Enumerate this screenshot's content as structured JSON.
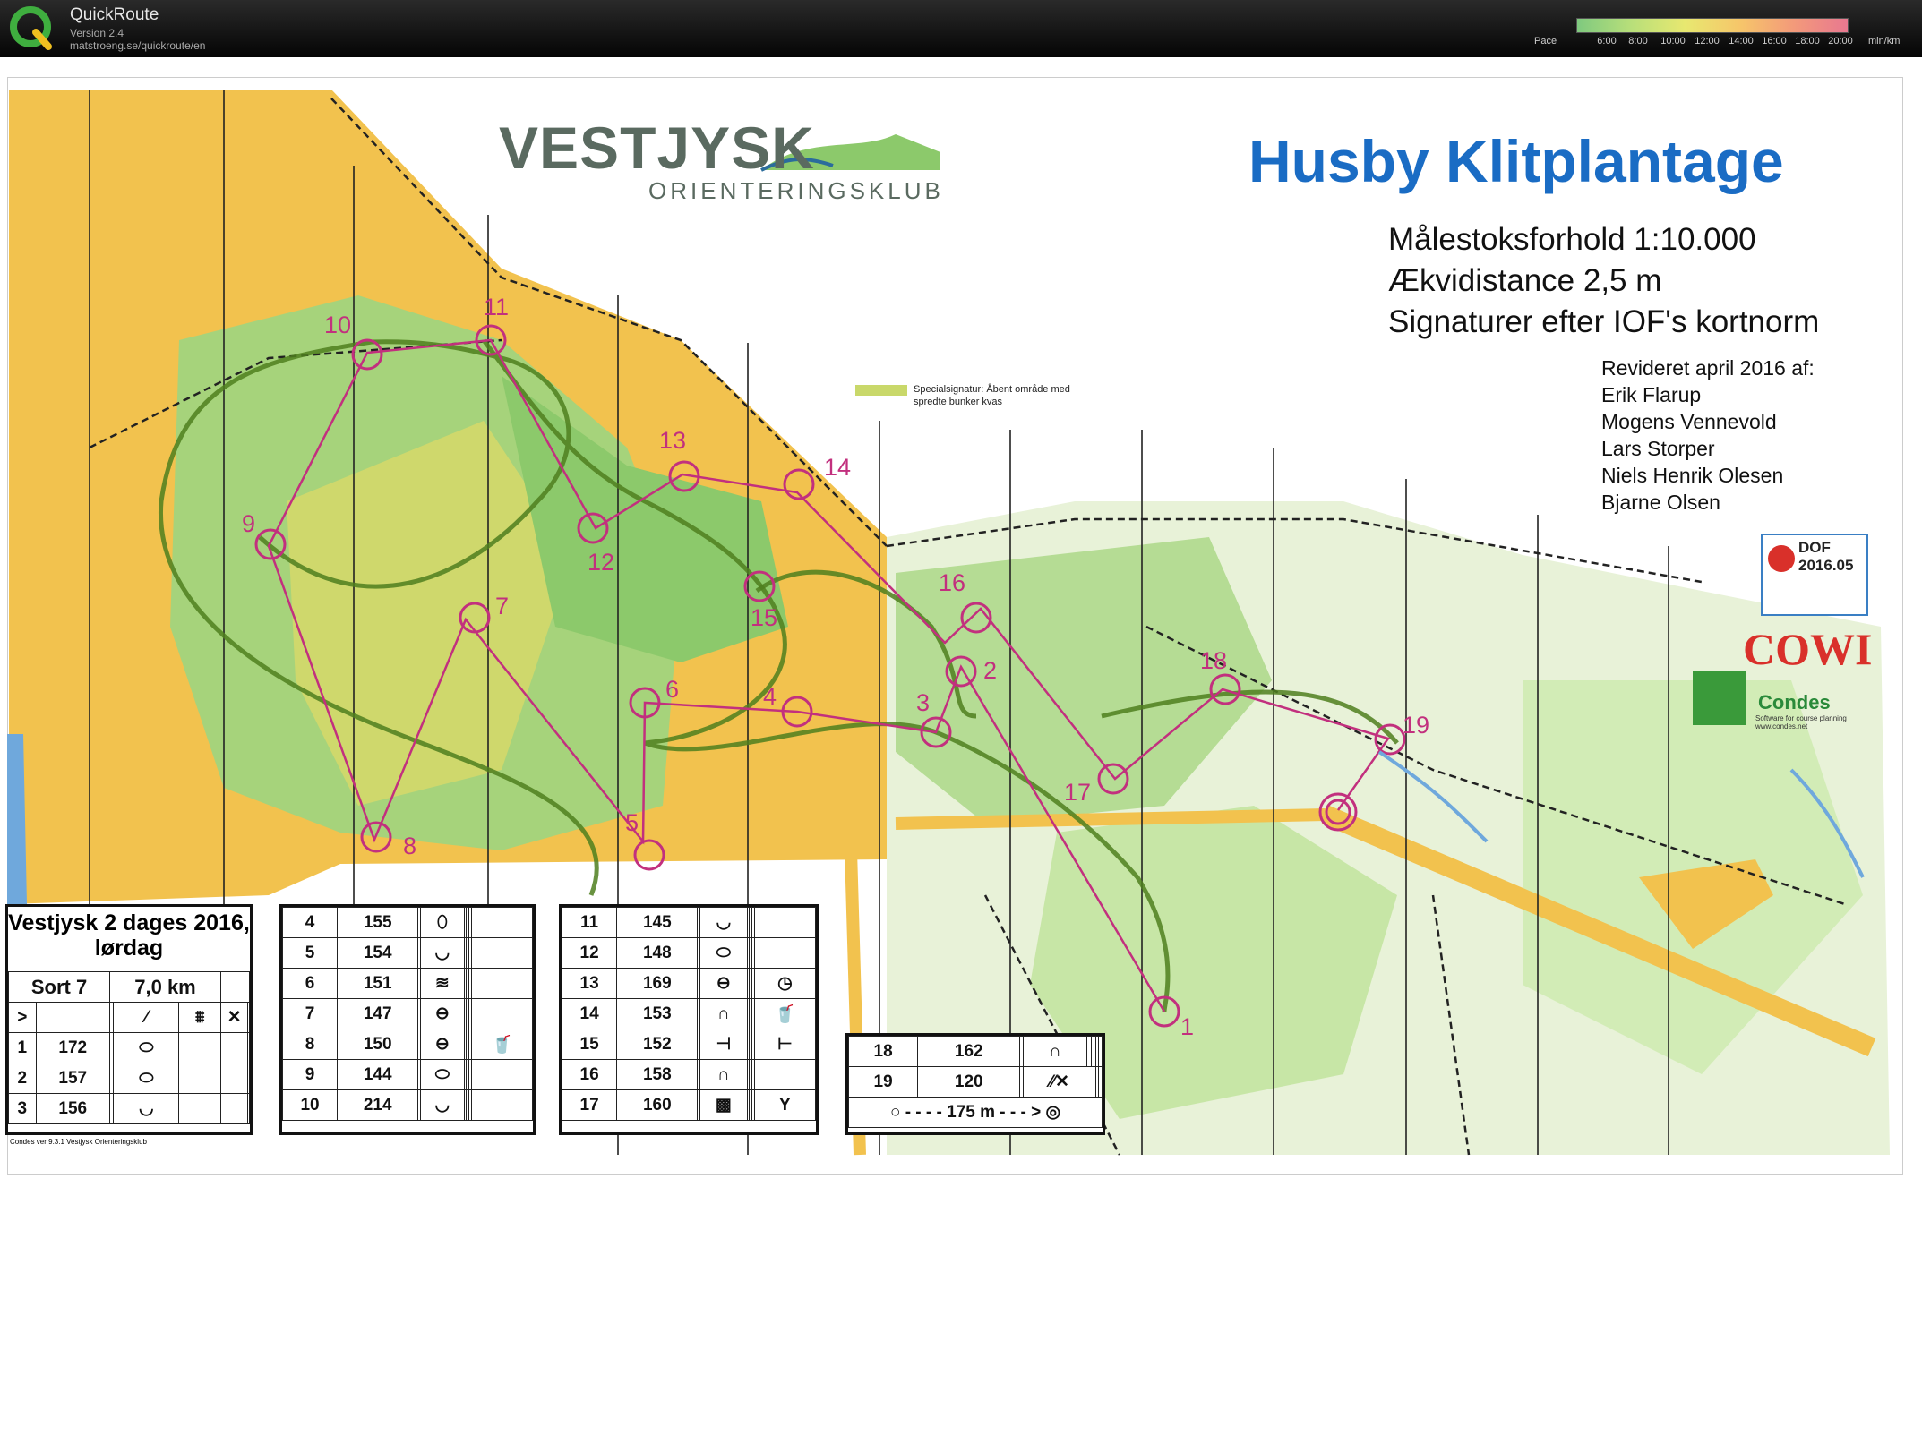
{
  "app": {
    "title": "QuickRoute",
    "version": "Version 2.4",
    "url": "matstroeng.se/quickroute/en"
  },
  "pace": {
    "label": "Pace",
    "ticks": [
      "6:00",
      "8:00",
      "10:00",
      "12:00",
      "14:00",
      "16:00",
      "18:00",
      "20:00"
    ],
    "unit": "min/km",
    "gradient": [
      "#7fc97f",
      "#b8df7a",
      "#e8e870",
      "#f6c66a",
      "#f39a7a",
      "#e87890"
    ]
  },
  "map": {
    "club_name": "VESTJYSK",
    "club_sub": "ORIENTERINGSKLUB",
    "title": "Husby Klitplantage",
    "scale": "Målestoksforhold 1:10.000",
    "contour": "Ækvidistance 2,5 m",
    "symbols": "Signaturer efter IOF's kortnorm",
    "revised_label": "Revideret april 2016 af:",
    "revisers": [
      "Erik Flarup",
      "Mogens Vennevold",
      "Lars Storper",
      "Niels Henrik Olesen",
      "Bjarne Olsen"
    ],
    "special_legend": "Specialsignatur: Åbent område med spredte bunker kvas",
    "dof": "DOF 2016.05",
    "cowi": "COWI",
    "condes": "Condes",
    "condes_sub": "Software for course planning www.condes.net",
    "colors": {
      "yellow": "#f2c24e",
      "green": "#8cc96b",
      "course": "#c2307e",
      "route": "#5a8a2a",
      "track": "#222222",
      "water": "#6fa8dc"
    },
    "controls": [
      "1",
      "2",
      "3",
      "4",
      "5",
      "6",
      "7",
      "8",
      "9",
      "10",
      "11",
      "12",
      "13",
      "14",
      "15",
      "16",
      "17",
      "18",
      "19"
    ]
  },
  "descriptions": {
    "title": "Vestjysk 2 dages 2016, lørdag",
    "course": "Sort 7",
    "length": "7,0 km",
    "footer": "Condes ver 9.3.1 Vestjysk Orienteringsklub",
    "col1": [
      {
        "n": "1",
        "code": "172",
        "sym": "⬭"
      },
      {
        "n": "2",
        "code": "157",
        "sym": "⬭"
      },
      {
        "n": "3",
        "code": "156",
        "sym": "◡"
      }
    ],
    "col2": [
      {
        "n": "4",
        "code": "155",
        "sym": "⬯",
        "extra": ""
      },
      {
        "n": "5",
        "code": "154",
        "sym": "◡",
        "extra": ""
      },
      {
        "n": "6",
        "code": "151",
        "sym": "≋",
        "extra": ""
      },
      {
        "n": "7",
        "code": "147",
        "sym": "⊖",
        "extra": ""
      },
      {
        "n": "8",
        "code": "150",
        "sym": "⊖",
        "extra": "🥤"
      },
      {
        "n": "9",
        "code": "144",
        "sym": "⬭",
        "extra": ""
      },
      {
        "n": "10",
        "code": "214",
        "sym": "◡",
        "extra": ""
      }
    ],
    "col3": [
      {
        "n": "11",
        "code": "145",
        "sym": "◡",
        "extra": ""
      },
      {
        "n": "12",
        "code": "148",
        "sym": "⬭",
        "extra": ""
      },
      {
        "n": "13",
        "code": "169",
        "sym": "⊖",
        "extra": "◷"
      },
      {
        "n": "14",
        "code": "153",
        "sym": "∩",
        "extra": "🥤"
      },
      {
        "n": "15",
        "code": "152",
        "sym": "⊣",
        "extra": "⊢"
      },
      {
        "n": "16",
        "code": "158",
        "sym": "∩",
        "extra": ""
      },
      {
        "n": "17",
        "code": "160",
        "sym": "▩",
        "extra": "Y"
      }
    ],
    "col4": [
      {
        "n": "18",
        "code": "162",
        "sym": "∩"
      },
      {
        "n": "19",
        "code": "120",
        "sym": "⁄⁄✕"
      }
    ],
    "finish": "175 m"
  }
}
